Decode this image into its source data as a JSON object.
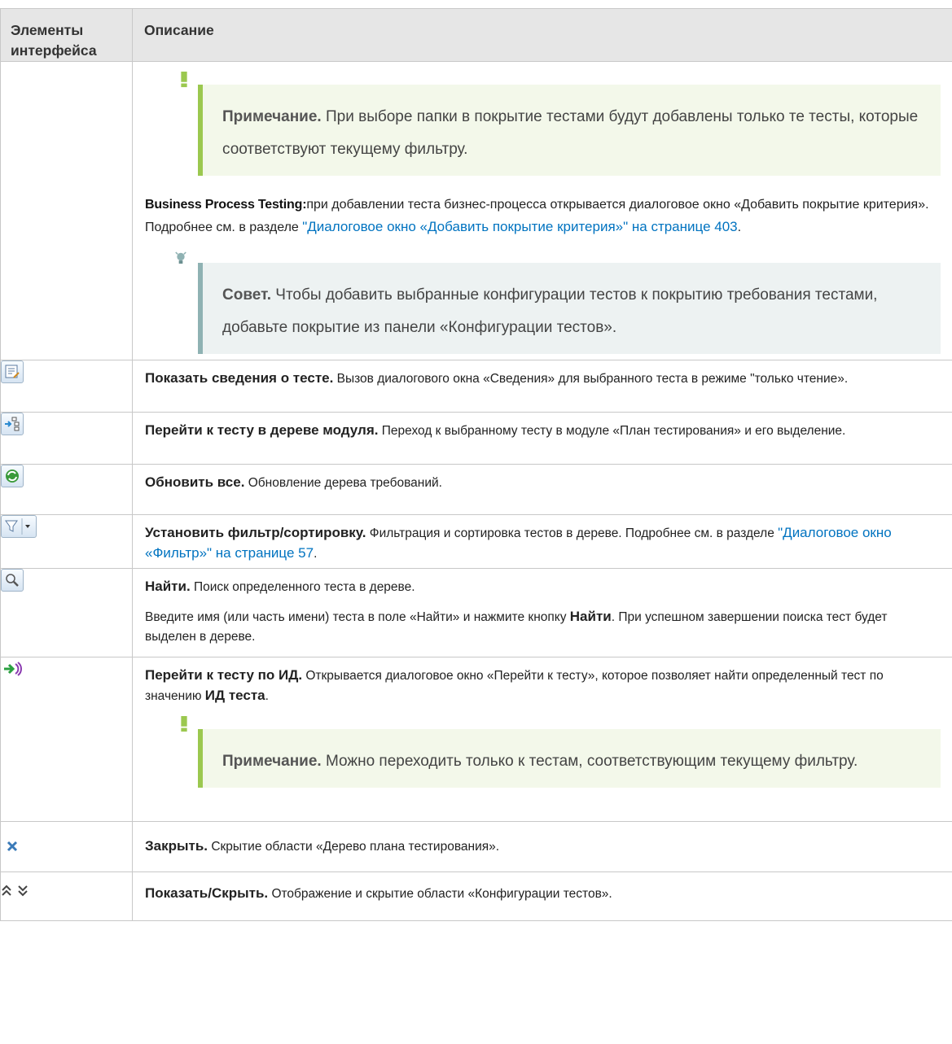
{
  "header": {
    "col1": "Элементы интерфейса",
    "col2": "Описание"
  },
  "row0": {
    "note1_label": "Примечание.",
    "note1_text": " При выборе папки в покрытие тестами будут добавлены только те тесты, которые соответствуют текущему фильтру.",
    "bpt_label": "Business Process Testing:",
    "bpt_text": "при добавлении теста бизнес-процесса открывается диалоговое окно «Добавить покрытие критерия». Подробнее см. в разделе ",
    "bpt_link": "\"Диалоговое окно «Добавить покрытие критерия»\" на странице 403",
    "bpt_end": ".",
    "tip_label": "Совет.",
    "tip_text": " Чтобы добавить выбранные конфигурации тестов к покрытию требования тестами, добавьте покрытие из панели «Конфигурации тестов»."
  },
  "rows": {
    "details": {
      "title": "Показать сведения о тесте.",
      "text": " Вызов диалогового окна «Сведения» для выбранного теста в режиме \"только чтение»."
    },
    "goto_tree": {
      "title": "Перейти к тесту в дереве модуля.",
      "text": " Переход к выбранному тесту в модуле «План тестирования» и его выделение."
    },
    "refresh": {
      "title": "Обновить все.",
      "text": " Обновление дерева требований."
    },
    "filter": {
      "title": "Установить фильтр/сортировку.",
      "text": " Фильтрация и сортировка тестов в дереве. Подробнее см. в разделе ",
      "link": "\"Диалоговое окно «Фильтр»\" на странице 57",
      "end": "."
    },
    "find": {
      "title": "Найти.",
      "text": " Поиск определенного теста в дереве.",
      "p2_a": "Введите имя (или часть имени) теста в поле «Найти» и нажмите кнопку ",
      "p2_b": "Найти",
      "p2_c": ". При успешном завершении поиска тест будет выделен в дереве."
    },
    "goto_id": {
      "title": "Перейти к тесту по ИД.",
      "text": " Открывается диалоговое окно «Перейти к тесту», которое позволяет найти определенный тест по значению ",
      "bold": "ИД теста",
      "end": ".",
      "note_label": "Примечание.",
      "note_text": " Можно переходить только к тестам, соответствующим текущему фильтру."
    },
    "close": {
      "title": "Закрыть.",
      "text": " Скрытие области «Дерево плана тестирования»."
    },
    "showhide": {
      "title": "Показать/Скрыть.",
      "text": " Отображение и скрытие области «Конфигурации тестов»."
    }
  },
  "icons": [
    "test-details-icon",
    "goto-tree-icon",
    "refresh-icon",
    "filter-icon",
    "find-icon",
    "goto-id-icon",
    "close-icon",
    "expand-collapse-icon"
  ]
}
